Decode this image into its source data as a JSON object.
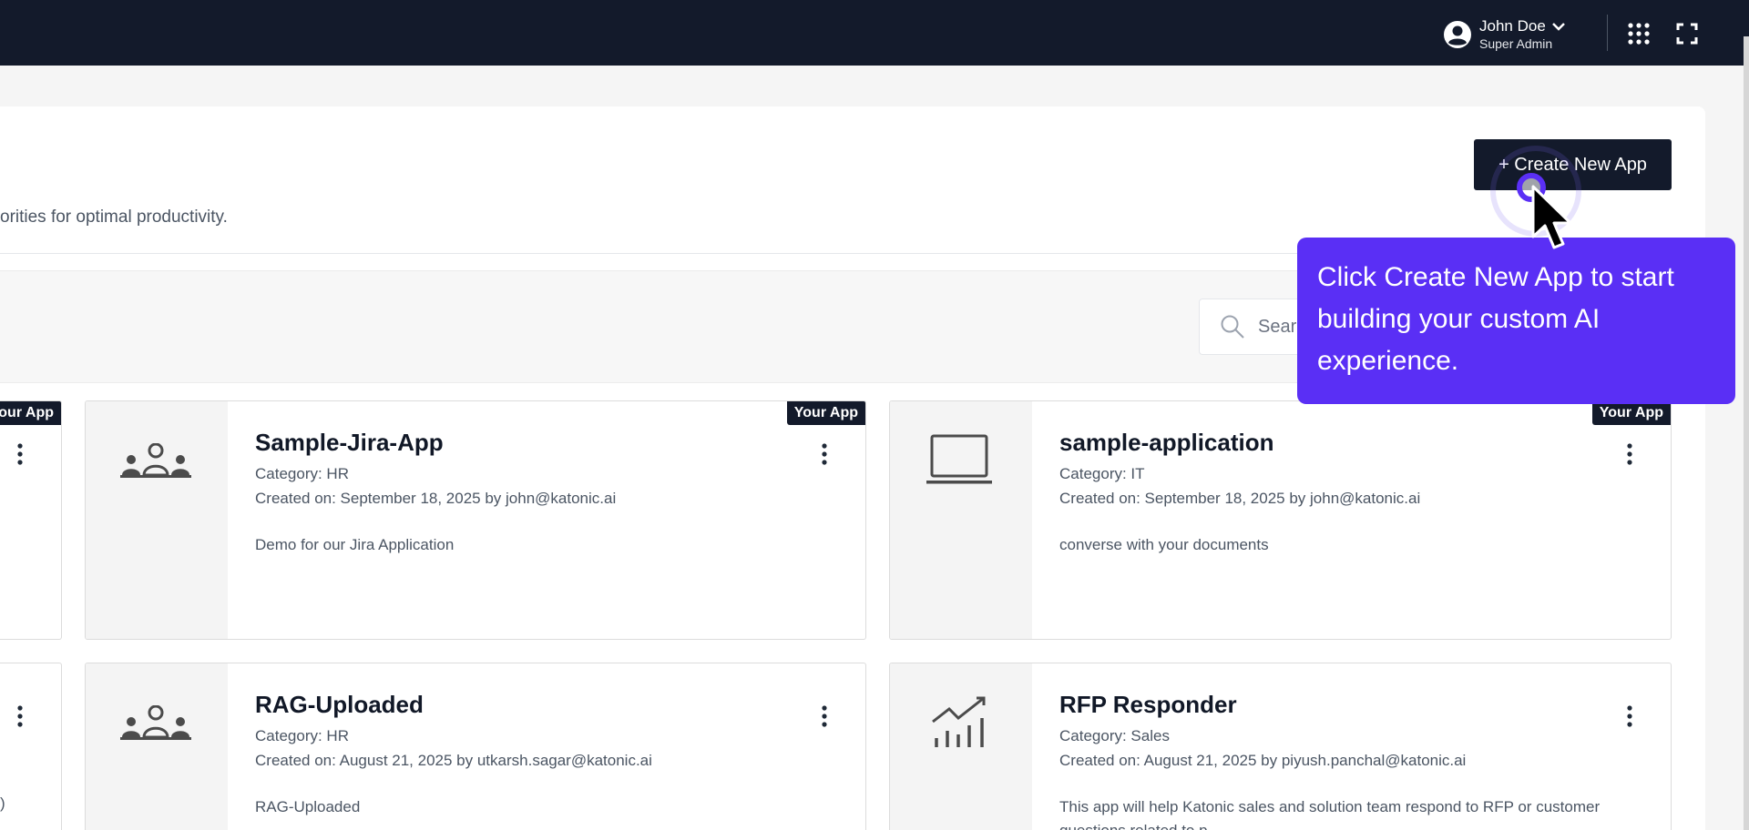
{
  "header": {
    "user_name": "John Doe",
    "user_role": "Super Admin"
  },
  "page": {
    "subtitle_fragment": "orities for optimal productivity.",
    "create_button_label": "+ Create New App",
    "search_placeholder": "Search"
  },
  "cards": [
    {
      "title": "Sample-Jira-App",
      "category": "Category: HR",
      "created": "Created on: September 18, 2025 by john@katonic.ai",
      "description": "Demo for our Jira Application",
      "badge": "Your App",
      "icon": "people-group-icon"
    },
    {
      "title": "sample-application",
      "category": "Category: IT",
      "created": "Created on: September 18, 2025 by john@katonic.ai",
      "description": "converse with your documents",
      "badge": "Your App",
      "icon": "laptop-icon"
    },
    {
      "title": "RAG-Uploaded",
      "category": "Category: HR",
      "created": "Created on: August 21, 2025 by utkarsh.sagar@katonic.ai",
      "description": "RAG-Uploaded",
      "icon": "people-group-icon"
    },
    {
      "title": "RFP Responder",
      "category": "Category: Sales",
      "created": "Created on: August 21, 2025 by piyush.panchal@katonic.ai",
      "description": "This app will help Katonic sales and solution team respond to RFP or customer",
      "description_line2": "questions related to p",
      "icon": "chart-growth-icon"
    }
  ],
  "partial_cards": {
    "top_badge": "our App",
    "bottom_fragment": ")"
  },
  "tooltip": {
    "text": "Click Create New App to start building your custom AI experience."
  },
  "colors": {
    "topbar": "#131a2b",
    "accent": "#5a2ff5",
    "button": "#131a2b"
  }
}
